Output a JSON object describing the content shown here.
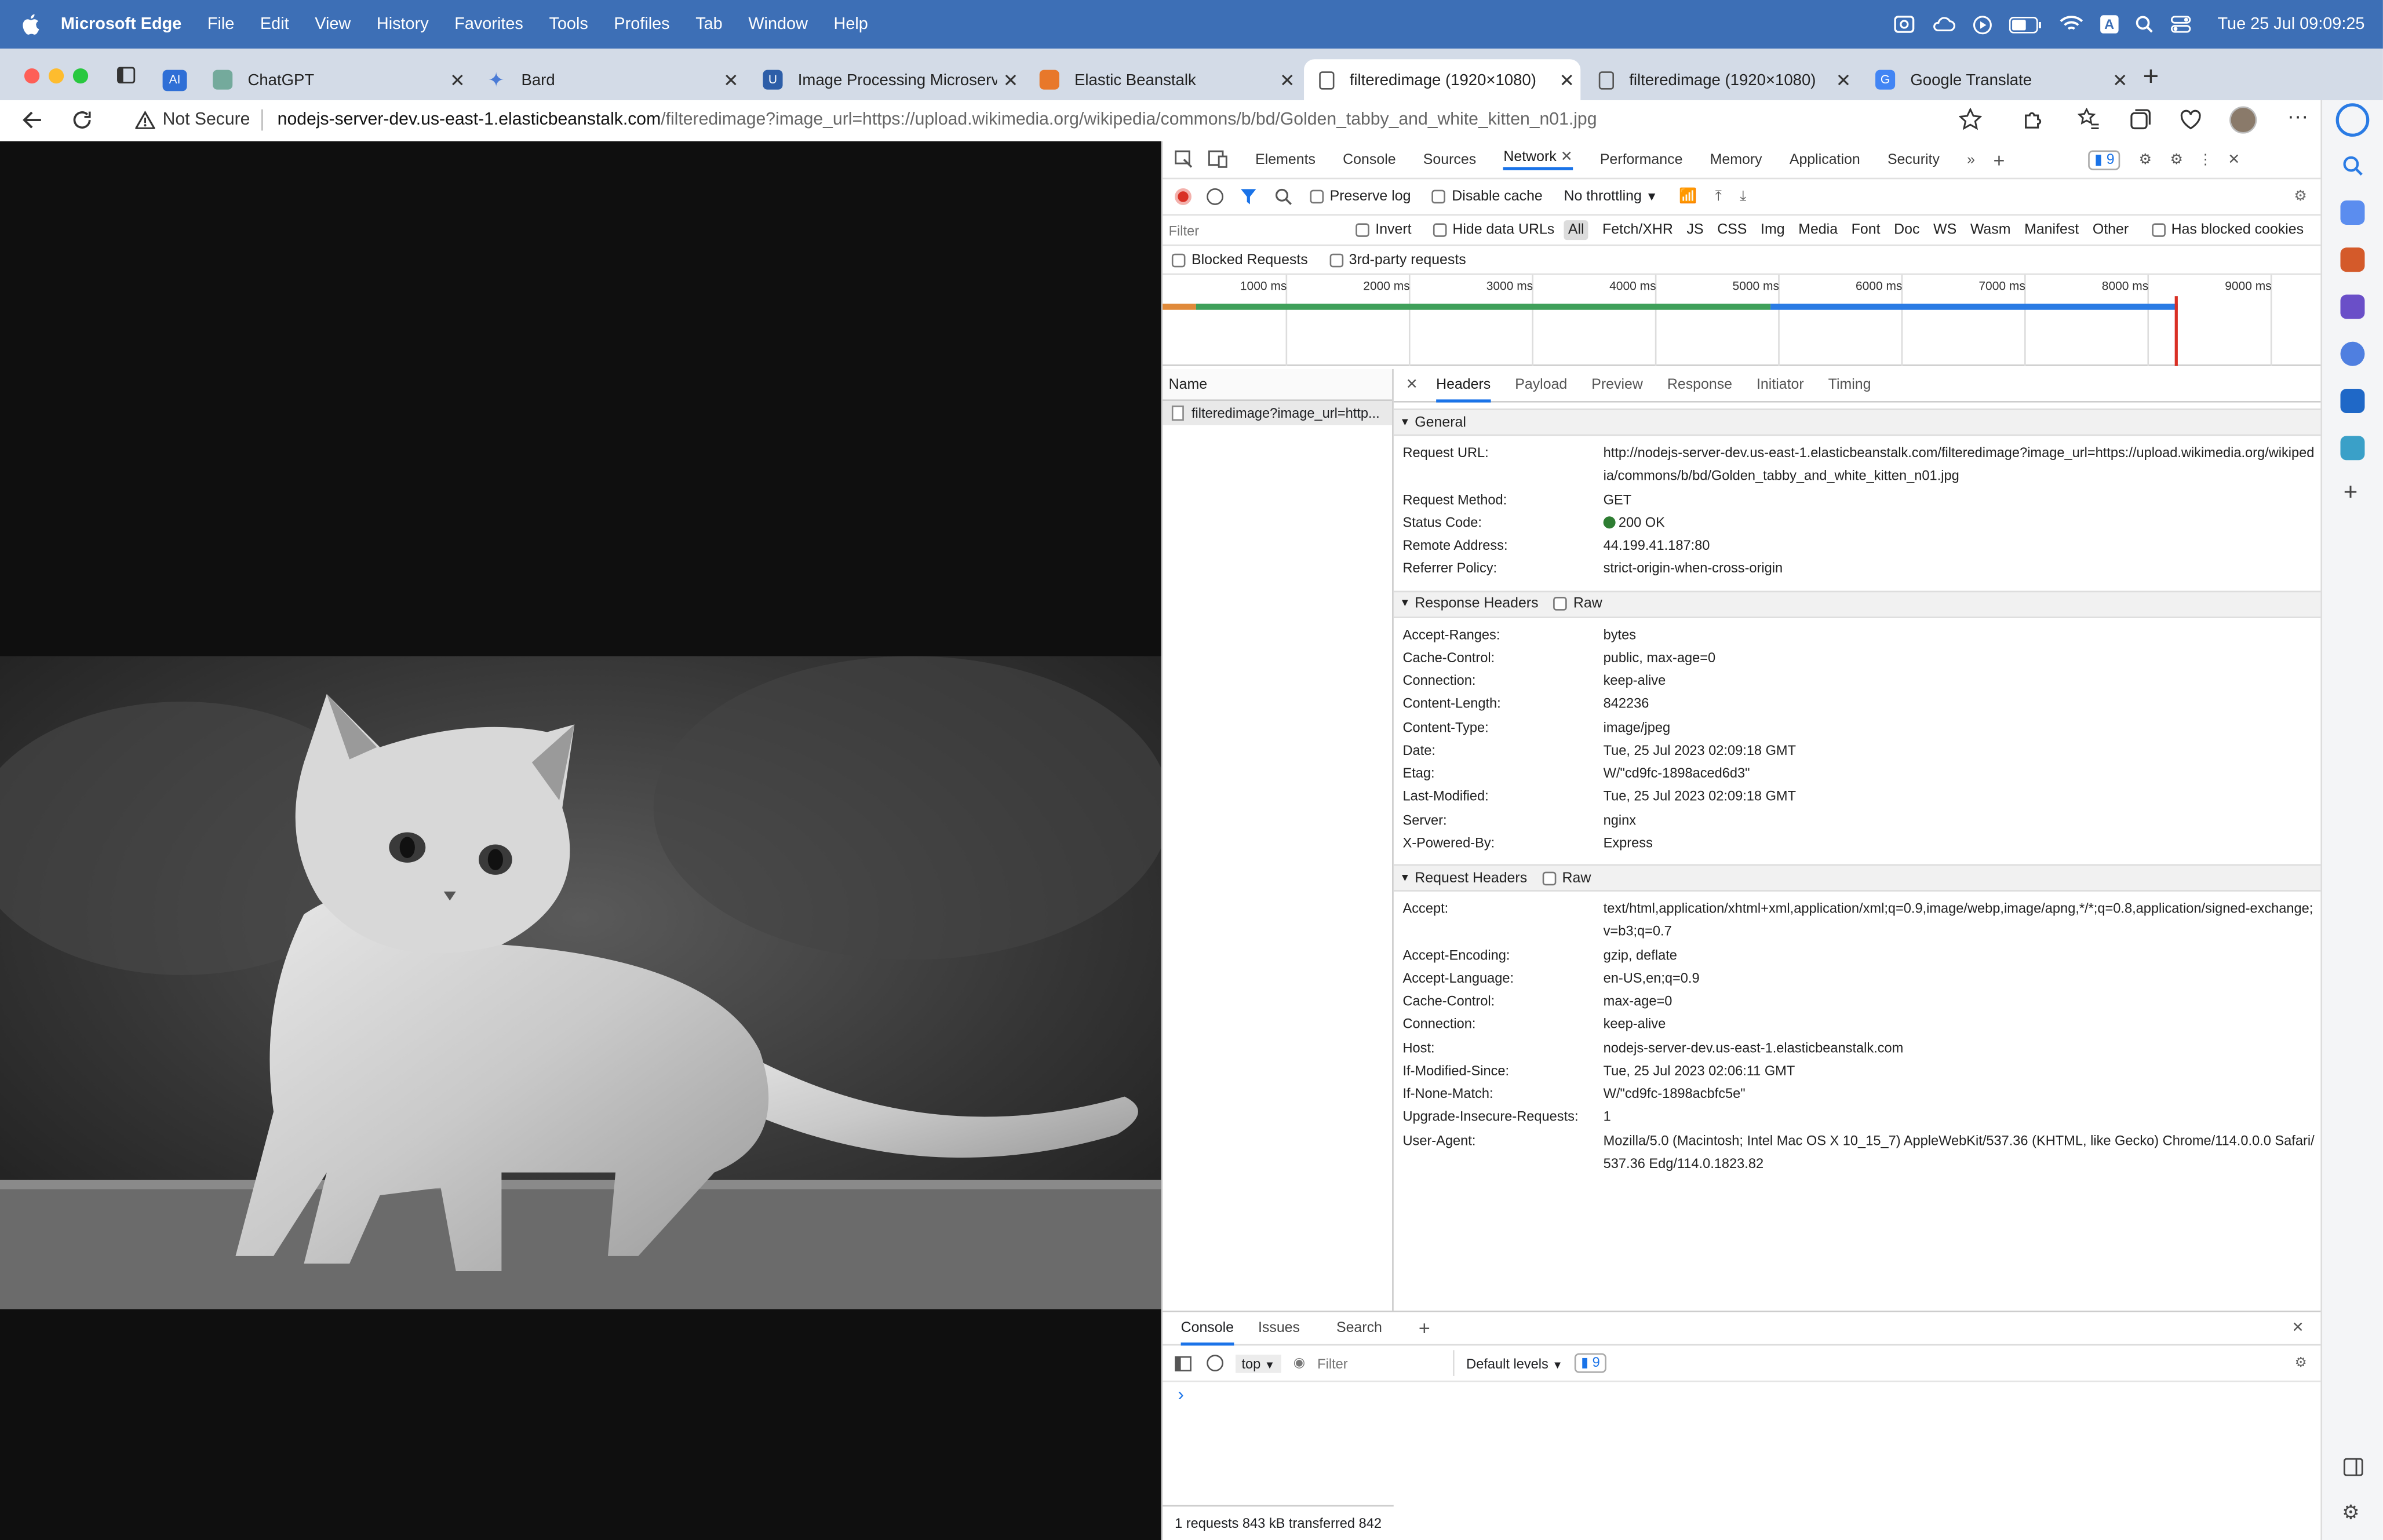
{
  "menubar": {
    "app_name": "Microsoft Edge",
    "items": [
      "File",
      "Edit",
      "View",
      "History",
      "Favorites",
      "Tools",
      "Profiles",
      "Tab",
      "Window",
      "Help"
    ],
    "status_ai_badge": "A",
    "clock": "Tue 25 Jul  09:09:25"
  },
  "tabs": [
    {
      "title": "",
      "favicon": "AI"
    },
    {
      "title": "ChatGPT",
      "favicon": ""
    },
    {
      "title": "Bard",
      "favicon": ""
    },
    {
      "title": "Image Processing Microservice",
      "favicon": ""
    },
    {
      "title": "Elastic Beanstalk",
      "favicon": ""
    },
    {
      "title": "filteredimage (1920×1080)",
      "favicon": ""
    },
    {
      "title": "filteredimage (1920×1080)",
      "favicon": ""
    },
    {
      "title": "Google Translate",
      "favicon": ""
    }
  ],
  "address": {
    "security": "Not Secure",
    "host": "nodejs-server-dev.us-east-1.elasticbeanstalk.com",
    "path": "/filteredimage?image_url=https://upload.wikimedia.org/wikipedia/commons/b/bd/Golden_tabby_and_white_kitten_n01.jpg"
  },
  "devtools": {
    "panels": [
      "Elements",
      "Console",
      "Sources",
      "Network",
      "Performance",
      "Memory",
      "Application",
      "Security"
    ],
    "issue_count": "9",
    "preserve_log": "Preserve log",
    "disable_cache": "Disable cache",
    "throttling": "No throttling",
    "filter_placeholder": "Filter",
    "invert": "Invert",
    "hide_data_urls": "Hide data URLs",
    "types": [
      "All",
      "Fetch/XHR",
      "JS",
      "CSS",
      "Img",
      "Media",
      "Font",
      "Doc",
      "WS",
      "Wasm",
      "Manifest",
      "Other"
    ],
    "has_blocked_cookies": "Has blocked cookies",
    "blocked_requests": "Blocked Requests",
    "third_party": "3rd-party requests",
    "timeline_ticks": [
      "1000 ms",
      "2000 ms",
      "3000 ms",
      "4000 ms",
      "5000 ms",
      "6000 ms",
      "7000 ms",
      "8000 ms",
      "9000 ms"
    ],
    "name_header": "Name",
    "request_name": "filteredimage?image_url=http...",
    "status_summary": "1 requests  843 kB transferred  842",
    "detail_tabs": [
      "Headers",
      "Payload",
      "Preview",
      "Response",
      "Initiator",
      "Timing"
    ],
    "general_title": "General",
    "general": [
      {
        "k": "Request URL:",
        "v": "http://nodejs-server-dev.us-east-1.elasticbeanstalk.com/filteredimage?image_url=https://upload.wikimedia.org/wikipedia/commons/b/bd/Golden_tabby_and_white_kitten_n01.jpg"
      },
      {
        "k": "Request Method:",
        "v": "GET"
      },
      {
        "k": "Status Code:",
        "v": "200 OK"
      },
      {
        "k": "Remote Address:",
        "v": "44.199.41.187:80"
      },
      {
        "k": "Referrer Policy:",
        "v": "strict-origin-when-cross-origin"
      }
    ],
    "response_title": "Response Headers",
    "raw_label": "Raw",
    "response_headers": [
      {
        "k": "Accept-Ranges:",
        "v": "bytes"
      },
      {
        "k": "Cache-Control:",
        "v": "public, max-age=0"
      },
      {
        "k": "Connection:",
        "v": "keep-alive"
      },
      {
        "k": "Content-Length:",
        "v": "842236"
      },
      {
        "k": "Content-Type:",
        "v": "image/jpeg"
      },
      {
        "k": "Date:",
        "v": "Tue, 25 Jul 2023 02:09:18 GMT"
      },
      {
        "k": "Etag:",
        "v": "W/\"cd9fc-1898aced6d3\""
      },
      {
        "k": "Last-Modified:",
        "v": "Tue, 25 Jul 2023 02:09:18 GMT"
      },
      {
        "k": "Server:",
        "v": "nginx"
      },
      {
        "k": "X-Powered-By:",
        "v": "Express"
      }
    ],
    "request_title": "Request Headers",
    "request_headers": [
      {
        "k": "Accept:",
        "v": "text/html,application/xhtml+xml,application/xml;q=0.9,image/webp,image/apng,*/*;q=0.8,application/signed-exchange;v=b3;q=0.7"
      },
      {
        "k": "Accept-Encoding:",
        "v": "gzip, deflate"
      },
      {
        "k": "Accept-Language:",
        "v": "en-US,en;q=0.9"
      },
      {
        "k": "Cache-Control:",
        "v": "max-age=0"
      },
      {
        "k": "Connection:",
        "v": "keep-alive"
      },
      {
        "k": "Host:",
        "v": "nodejs-server-dev.us-east-1.elasticbeanstalk.com"
      },
      {
        "k": "If-Modified-Since:",
        "v": "Tue, 25 Jul 2023 02:06:11 GMT"
      },
      {
        "k": "If-None-Match:",
        "v": "W/\"cd9fc-1898acbfc5e\""
      },
      {
        "k": "Upgrade-Insecure-Requests:",
        "v": "1"
      },
      {
        "k": "User-Agent:",
        "v": "Mozilla/5.0 (Macintosh; Intel Mac OS X 10_15_7) AppleWebKit/537.36 (KHTML, like Gecko) Chrome/114.0.0.0 Safari/537.36 Edg/114.0.1823.82"
      }
    ],
    "drawer_tabs": [
      "Console",
      "Issues",
      "Search"
    ],
    "context": "top",
    "console_filter_placeholder": "Filter",
    "default_levels": "Default levels",
    "console_issue_count": "9",
    "prompt": "›"
  },
  "colors": {
    "menubar": "#3d6fb6",
    "tabstrip": "#d3dbe7",
    "accent": "#1a73e8",
    "status_ok": "#2e7d32",
    "record": "#d93025"
  }
}
